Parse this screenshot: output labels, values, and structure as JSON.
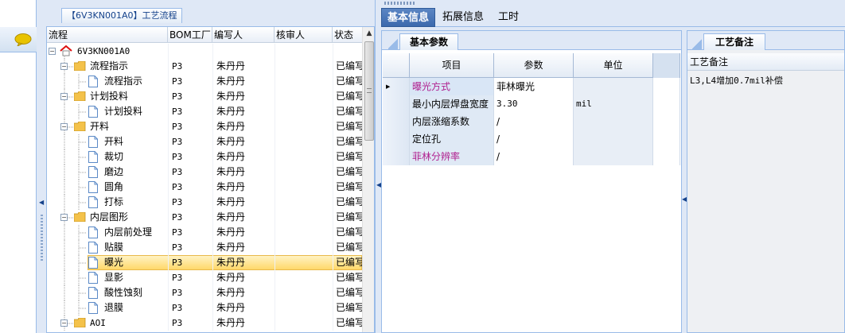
{
  "tree": {
    "title": "【6V3KN001A0】工艺流程",
    "columns": [
      "流程",
      "BOM工厂",
      "编写人",
      "核审人",
      "状态"
    ],
    "rows": [
      {
        "label": "6V3KN001A0",
        "level": 0,
        "kind": "root",
        "factory": "",
        "author": "",
        "reviewer": "",
        "status": ""
      },
      {
        "label": "流程指示",
        "level": 1,
        "kind": "folder",
        "factory": "P3",
        "author": "朱丹丹",
        "reviewer": "",
        "status": "已编写"
      },
      {
        "label": "流程指示",
        "level": 2,
        "kind": "doc",
        "factory": "P3",
        "author": "朱丹丹",
        "reviewer": "",
        "status": "已编写"
      },
      {
        "label": "计划投料",
        "level": 1,
        "kind": "folder",
        "factory": "P3",
        "author": "朱丹丹",
        "reviewer": "",
        "status": "已编写"
      },
      {
        "label": "计划投料",
        "level": 2,
        "kind": "doc",
        "factory": "P3",
        "author": "朱丹丹",
        "reviewer": "",
        "status": "已编写"
      },
      {
        "label": "开料",
        "level": 1,
        "kind": "folder",
        "factory": "P3",
        "author": "朱丹丹",
        "reviewer": "",
        "status": "已编写"
      },
      {
        "label": "开料",
        "level": 2,
        "kind": "doc",
        "factory": "P3",
        "author": "朱丹丹",
        "reviewer": "",
        "status": "已编写"
      },
      {
        "label": "裁切",
        "level": 2,
        "kind": "doc",
        "factory": "P3",
        "author": "朱丹丹",
        "reviewer": "",
        "status": "已编写"
      },
      {
        "label": "磨边",
        "level": 2,
        "kind": "doc",
        "factory": "P3",
        "author": "朱丹丹",
        "reviewer": "",
        "status": "已编写"
      },
      {
        "label": "圆角",
        "level": 2,
        "kind": "doc",
        "factory": "P3",
        "author": "朱丹丹",
        "reviewer": "",
        "status": "已编写"
      },
      {
        "label": "打标",
        "level": 2,
        "kind": "doc",
        "factory": "P3",
        "author": "朱丹丹",
        "reviewer": "",
        "status": "已编写"
      },
      {
        "label": "内层图形",
        "level": 1,
        "kind": "folder",
        "factory": "P3",
        "author": "朱丹丹",
        "reviewer": "",
        "status": "已编写"
      },
      {
        "label": "内层前处理",
        "level": 2,
        "kind": "doc",
        "factory": "P3",
        "author": "朱丹丹",
        "reviewer": "",
        "status": "已编写"
      },
      {
        "label": "贴膜",
        "level": 2,
        "kind": "doc",
        "factory": "P3",
        "author": "朱丹丹",
        "reviewer": "",
        "status": "已编写"
      },
      {
        "label": "曝光",
        "level": 2,
        "kind": "doc",
        "factory": "P3",
        "author": "朱丹丹",
        "reviewer": "",
        "status": "已编写",
        "selected": true
      },
      {
        "label": "显影",
        "level": 2,
        "kind": "doc",
        "factory": "P3",
        "author": "朱丹丹",
        "reviewer": "",
        "status": "已编写"
      },
      {
        "label": "酸性蚀刻",
        "level": 2,
        "kind": "doc",
        "factory": "P3",
        "author": "朱丹丹",
        "reviewer": "",
        "status": "已编写"
      },
      {
        "label": "退膜",
        "level": 2,
        "kind": "doc",
        "factory": "P3",
        "author": "朱丹丹",
        "reviewer": "",
        "status": "已编写"
      },
      {
        "label": "AOI",
        "level": 1,
        "kind": "folder",
        "factory": "P3",
        "author": "朱丹丹",
        "reviewer": "",
        "status": "已编写"
      }
    ]
  },
  "tabs": [
    "基本信息",
    "拓展信息",
    "工时"
  ],
  "params": {
    "subtab": "基本参数",
    "columns": [
      "项目",
      "参数",
      "单位"
    ],
    "rows": [
      {
        "item": "曝光方式",
        "value": "菲林曝光",
        "unit": "",
        "pink": true,
        "current": true
      },
      {
        "item": "最小内层焊盘宽度",
        "value": "3.30",
        "unit": "mil",
        "pink": false
      },
      {
        "item": "内层涨缩系数",
        "value": "/",
        "unit": "",
        "pink": false
      },
      {
        "item": "定位孔",
        "value": "/",
        "unit": "",
        "pink": false
      },
      {
        "item": "菲林分辨率",
        "value": "/",
        "unit": "",
        "pink": true
      }
    ]
  },
  "notes": {
    "tab": "工艺备注",
    "header": "工艺备注",
    "text": "L3,L4增加0.7mil补偿"
  },
  "colors": {
    "accent": "#3c69ad",
    "border": "#99bbe8",
    "pink_text": "#b0208f",
    "selection": "#ffd86a",
    "folder": "#f4c24a"
  }
}
